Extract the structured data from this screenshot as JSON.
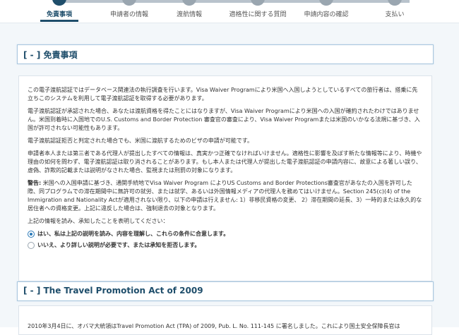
{
  "steps": [
    {
      "number": "1",
      "label": "免責事項",
      "active": true
    },
    {
      "number": "2",
      "label": "申請者の情報",
      "active": false
    },
    {
      "number": "3",
      "label": "渡航情報",
      "active": false
    },
    {
      "number": "4",
      "label": "適格性に関する質問",
      "active": false
    },
    {
      "number": "5",
      "label": "申請内容の確認",
      "active": false
    },
    {
      "number": "6",
      "label": "支払い",
      "active": false
    }
  ],
  "section1": {
    "bracket": "[ - ]",
    "title": "免責事項",
    "paragraphs": [
      "この電子渡航認証ではデータベース関連法の執行調査を行います。Visa Waiver Programにより米国へ入国しようとしているすべての旅行者は、搭乗に先立ちこのシステムを利用して電子渡航認証を取得する必要があります。",
      "電子渡航認証が承認された場合、あなたは渡航資格を得たことにはなりますが、Visa Waiver Programにより米国への入国が確約されたわけではありません。米国到着時に入国地でのU.S. Customs and Border Protection 審査官の審査により、Visa Waiver Programまたは米国のいかなる法規に基づき、入国が許可されない可能性もあります。",
      "電子渡航認証拒否と判定された場合でも、米国に渡航するためのビザの申請が可能です。",
      "申請者本人または第三者である代理人が提出したすべての情報は、真実かつ正確でなければいけません。適格性に影響を及ぼす新たな情報等により、時機や理由の如何を問わず、電子渡航認証は取り消されることがあります。もし本人または代理人が提出した電子渡航認証の申請内容に、故意による著しい誤り、虚偽、詐欺的記載または説明がなされた場合、監視または刑罰の対象になります。"
    ],
    "warning_label": "警告:",
    "warning_text": " 米国への入国申請に基づき、通関手続地でVisa Waiver Program によりUS Customs and Border Protections審査官があなたの入国を許可した際、同プログラムでの滞在期間中に無許可の就労、または就学、あるいは外国情報メディアの代理人を務めてはいけません。Section 245(c)(4) of the Immigration and Nationality Actが適用されない限り、以下の申請は行えません: 1）非移民資格の変更、 2）滞在期間の延長、3）一時的または永久的な居住者への資格変更。上記に違反した場合は、強制退去の対象となります。",
    "confirm_prompt": "上記の情報を読み、承知したことを表明してください：",
    "options": [
      {
        "label": "はい、私は上記の説明を読み、内容を理解し、これらの条件に合意します。",
        "checked": true
      },
      {
        "label": "いいえ、より詳しい説明が必要です、または承知を拒否します。",
        "checked": false
      }
    ]
  },
  "section2": {
    "bracket": "[ - ]",
    "title": "The Travel Promotion Act of 2009",
    "partial_text": "2010年3月4日に、オバマ大統領はTravel Promotion Act (TPA) of 2009, Pub. L. No. 111-145 に署名しました。これにより国土安全保障長官は"
  },
  "colors": {
    "accent": "#1f4e6b",
    "radio": "#2a79b8",
    "background": "#f3f7fa"
  }
}
